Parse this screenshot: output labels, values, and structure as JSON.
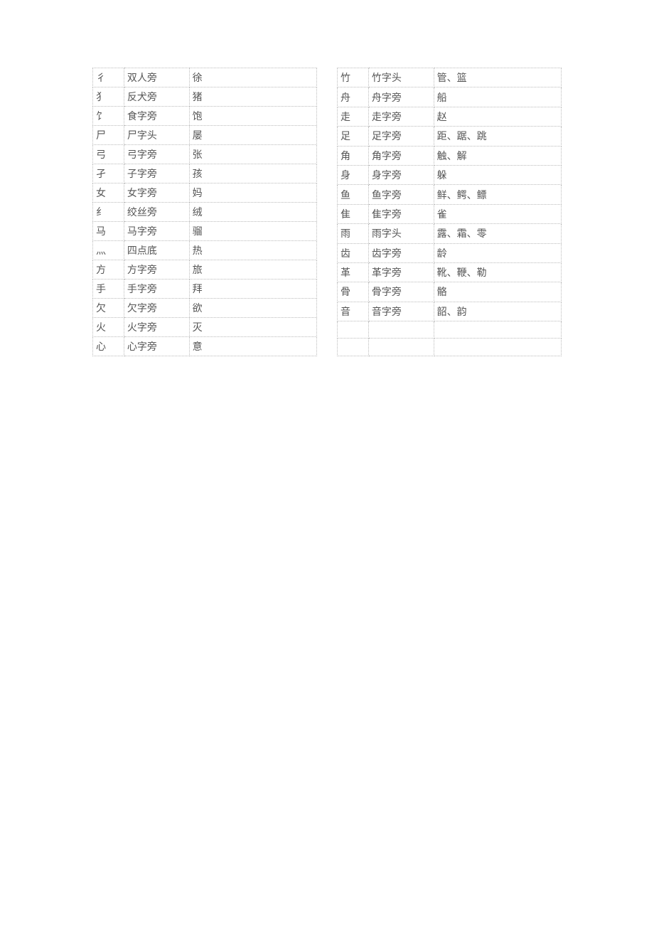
{
  "left": [
    {
      "radical": "彳",
      "name": "双人旁",
      "examples": "徐"
    },
    {
      "radical": "犭",
      "name": "反犬旁",
      "examples": "猪"
    },
    {
      "radical": "饣",
      "name": "食字旁",
      "examples": "饱"
    },
    {
      "radical": "尸",
      "name": "尸字头",
      "examples": "屡"
    },
    {
      "radical": "弓",
      "name": "弓字旁",
      "examples": "张"
    },
    {
      "radical": "孑",
      "name": "子字旁",
      "examples": "孩"
    },
    {
      "radical": "女",
      "name": "女字旁",
      "examples": "妈"
    },
    {
      "radical": "纟",
      "name": "绞丝旁",
      "examples": "绒"
    },
    {
      "radical": "马",
      "name": "马字旁",
      "examples": "骝"
    },
    {
      "radical": "灬",
      "name": "四点底",
      "examples": "热"
    },
    {
      "radical": "方",
      "name": "方字旁",
      "examples": "旅"
    },
    {
      "radical": "手",
      "name": "手字旁",
      "examples": "拜"
    },
    {
      "radical": "欠",
      "name": "欠字旁",
      "examples": "欲"
    },
    {
      "radical": "火",
      "name": "火字旁",
      "examples": "灭"
    },
    {
      "radical": "心",
      "name": "心字旁",
      "examples": "意"
    }
  ],
  "right": [
    {
      "radical": "竹",
      "name": "竹字头",
      "examples": "管、篮"
    },
    {
      "radical": "舟",
      "name": "舟字旁",
      "examples": "船"
    },
    {
      "radical": "走",
      "name": "走字旁",
      "examples": "赵"
    },
    {
      "radical": "足",
      "name": "足字旁",
      "examples": "距、踞、跳"
    },
    {
      "radical": "角",
      "name": "角字旁",
      "examples": "触、解"
    },
    {
      "radical": "身",
      "name": "身字旁",
      "examples": "躲"
    },
    {
      "radical": "鱼",
      "name": "鱼字旁",
      "examples": "鲜、鳄、鳔"
    },
    {
      "radical": "隹",
      "name": "隹字旁",
      "examples": "雀"
    },
    {
      "radical": "雨",
      "name": "雨字头",
      "examples": "露、霜、零"
    },
    {
      "radical": "齿",
      "name": "齿字旁",
      "examples": "龄"
    },
    {
      "radical": "革",
      "name": "革字旁",
      "examples": "靴、鞭、勒"
    },
    {
      "radical": "骨",
      "name": "骨字旁",
      "examples": "骼"
    },
    {
      "radical": "音",
      "name": "音字旁",
      "examples": "韶、韵"
    },
    {
      "radical": "",
      "name": "",
      "examples": ""
    },
    {
      "radical": "",
      "name": "",
      "examples": ""
    }
  ]
}
